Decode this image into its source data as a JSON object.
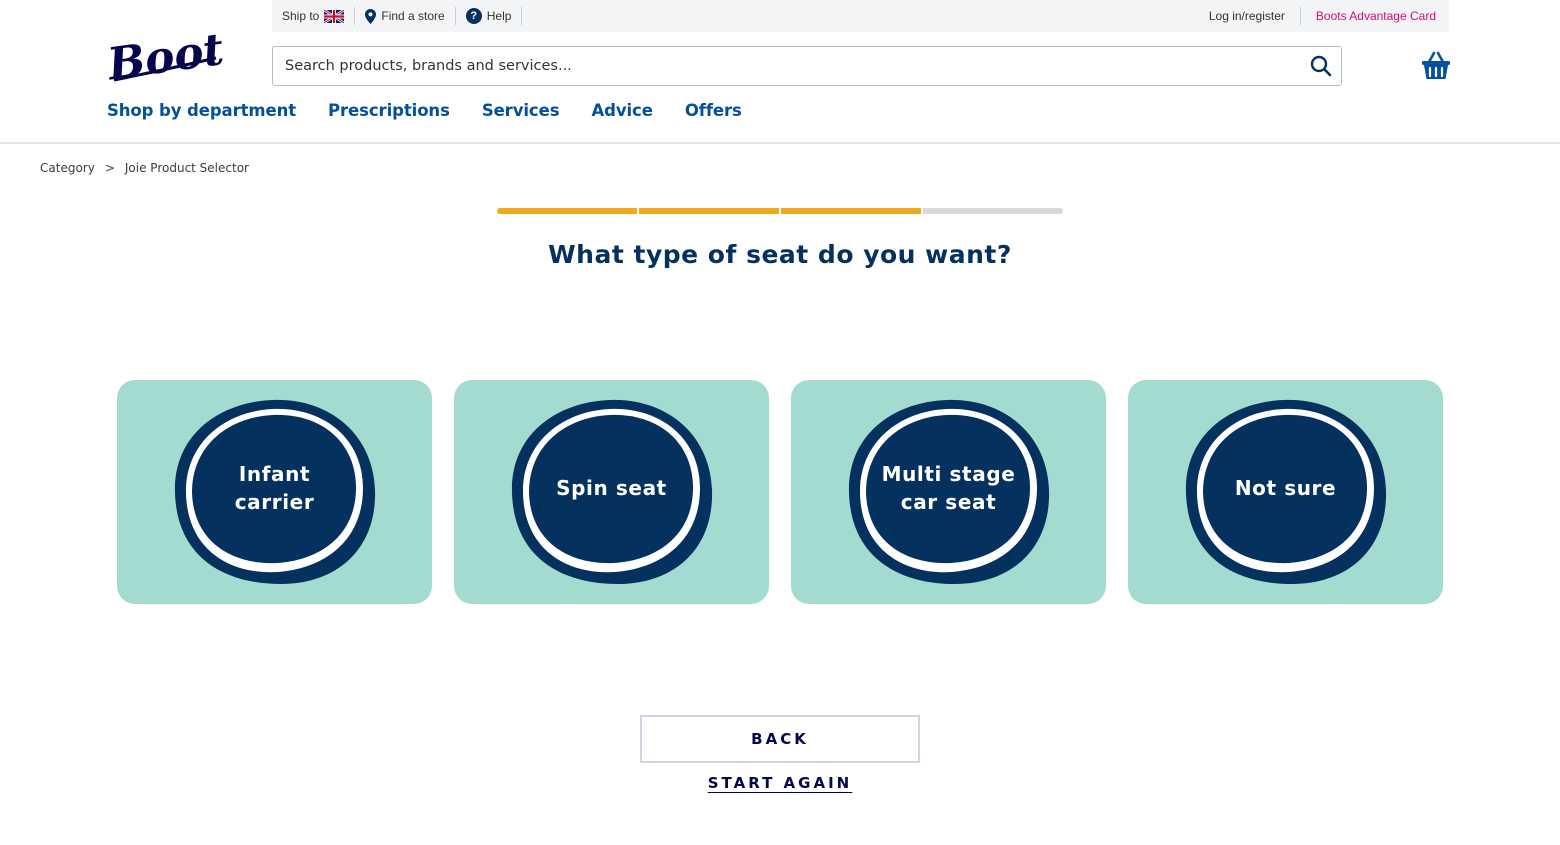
{
  "header": {
    "logo_text": "Boots",
    "utility": {
      "ship_to": "Ship to",
      "find_store": "Find a store",
      "help": "Help",
      "login": "Log in/register",
      "advantage_card": "Boots Advantage Card"
    },
    "search": {
      "placeholder": "Search products, brands and services..."
    },
    "nav": [
      {
        "label": "Shop by department"
      },
      {
        "label": "Prescriptions"
      },
      {
        "label": "Services"
      },
      {
        "label": "Advice"
      },
      {
        "label": "Offers"
      }
    ]
  },
  "breadcrumb": {
    "items": [
      "Category",
      "Joie Product Selector"
    ],
    "separator": ">"
  },
  "progress": {
    "completed_steps": 3,
    "total_steps": 4
  },
  "question": "What type of seat do you want?",
  "options": [
    {
      "label": "Infant carrier"
    },
    {
      "label": "Spin seat"
    },
    {
      "label": "Multi stage car seat"
    },
    {
      "label": "Not sure"
    }
  ],
  "footer": {
    "back_label": "BACK",
    "start_again_label": "START AGAIN"
  },
  "colors": {
    "brand_navy": "#05315e",
    "nav_blue": "#05509b",
    "card_mint": "#a4dbd1",
    "progress_amber": "#f0a81f",
    "advantage_pink": "#cc0f7d"
  }
}
